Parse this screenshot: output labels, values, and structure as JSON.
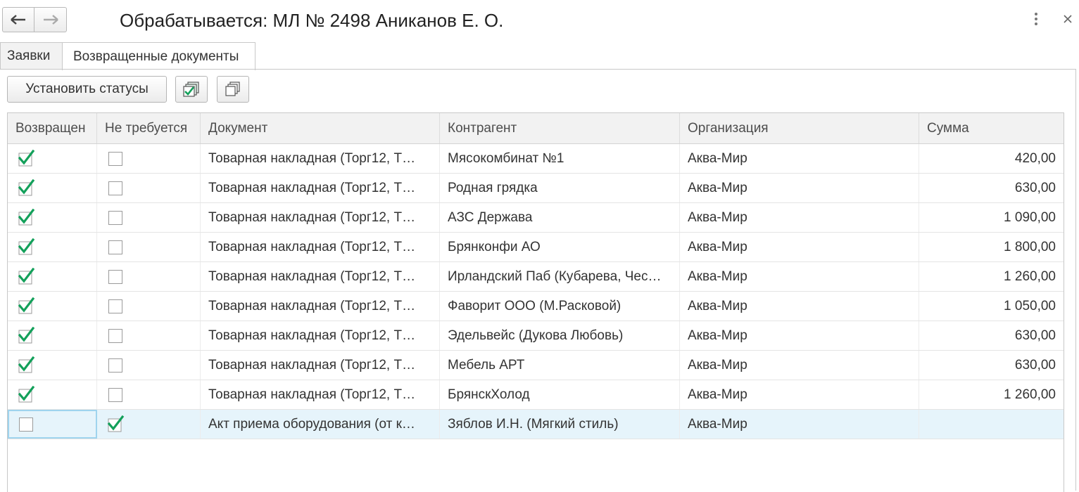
{
  "window": {
    "title": "Обрабатывается: МЛ № 2498 Аниканов Е. О.",
    "nav_back_icon": "arrow-left-icon",
    "nav_forward_icon": "arrow-right-icon",
    "menu_icon": "more-vertical-icon",
    "close_icon": "close-icon"
  },
  "tabs": [
    {
      "label": "Заявки",
      "active": false
    },
    {
      "label": "Возвращенные документы",
      "active": true
    }
  ],
  "toolbar": {
    "set_status_label": "Установить статусы",
    "check_all_icon": "check-all-icon",
    "copy_icon": "copy-icon"
  },
  "table": {
    "columns": [
      "Возвращен",
      "Не требуется",
      "Документ",
      "Контрагент",
      "Организация",
      "Сумма"
    ],
    "rows": [
      {
        "returned": true,
        "not_required": false,
        "document": "Товарная накладная (Торг12, Т…",
        "counterparty": "Мясокомбинат №1",
        "organization": "Аква-Мир",
        "sum": "420,00"
      },
      {
        "returned": true,
        "not_required": false,
        "document": "Товарная накладная (Торг12, Т…",
        "counterparty": "Родная грядка",
        "organization": "Аква-Мир",
        "sum": "630,00"
      },
      {
        "returned": true,
        "not_required": false,
        "document": "Товарная накладная (Торг12, Т…",
        "counterparty": "АЗС Держава",
        "organization": "Аква-Мир",
        "sum": "1 090,00"
      },
      {
        "returned": true,
        "not_required": false,
        "document": "Товарная накладная (Торг12, Т…",
        "counterparty": "Брянконфи АО",
        "organization": "Аква-Мир",
        "sum": "1 800,00"
      },
      {
        "returned": true,
        "not_required": false,
        "document": "Товарная накладная (Торг12, Т…",
        "counterparty": "Ирландский Паб (Кубарева, Чес…",
        "organization": "Аква-Мир",
        "sum": "1 260,00"
      },
      {
        "returned": true,
        "not_required": false,
        "document": "Товарная накладная (Торг12, Т…",
        "counterparty": "Фаворит ООО (М.Расковой)",
        "organization": "Аква-Мир",
        "sum": "1 050,00"
      },
      {
        "returned": true,
        "not_required": false,
        "document": "Товарная накладная (Торг12, Т…",
        "counterparty": "Эдельвейс (Дукова Любовь)",
        "organization": "Аква-Мир",
        "sum": "630,00"
      },
      {
        "returned": true,
        "not_required": false,
        "document": "Товарная накладная (Торг12, Т…",
        "counterparty": "Мебель АРТ",
        "organization": "Аква-Мир",
        "sum": "630,00"
      },
      {
        "returned": true,
        "not_required": false,
        "document": "Товарная накладная (Торг12, Т…",
        "counterparty": "БрянскХолод",
        "organization": "Аква-Мир",
        "sum": "1 260,00"
      },
      {
        "returned": false,
        "not_required": true,
        "document": "Акт приема оборудования (от к…",
        "counterparty": "Зяблов И.Н. (Мягкий стиль)",
        "organization": "Аква-Мир",
        "sum": "",
        "selected": true
      }
    ]
  },
  "colors": {
    "check_green": "#13a05a",
    "selection_bg": "#e6f4fb",
    "focus_border": "#9fd4ee"
  }
}
